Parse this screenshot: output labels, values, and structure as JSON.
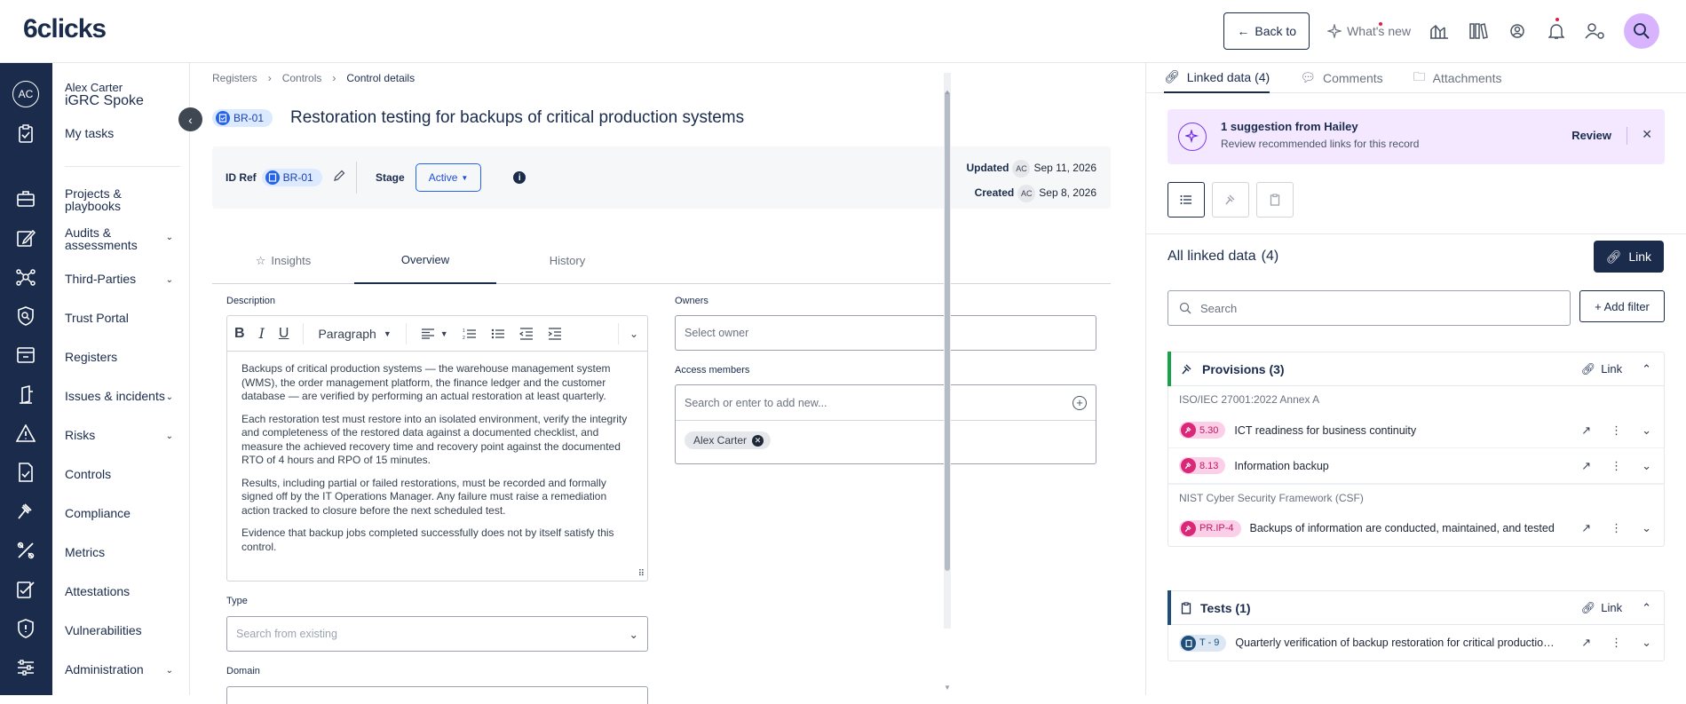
{
  "app": {
    "logo": "6clicks"
  },
  "topbar": {
    "back_label": "Back to",
    "whats_new_label": "What's new"
  },
  "user": {
    "initials": "AC",
    "name": "Alex Carter",
    "org": "iGRC Spoke"
  },
  "sidenav": {
    "my_tasks": "My tasks",
    "items": [
      {
        "label": "Projects & playbooks"
      },
      {
        "label": "Audits & assessments"
      },
      {
        "label": "Third-Parties"
      },
      {
        "label": "Trust Portal"
      },
      {
        "label": "Registers"
      },
      {
        "label": "Issues & incidents"
      },
      {
        "label": "Risks"
      },
      {
        "label": "Controls"
      },
      {
        "label": "Compliance"
      },
      {
        "label": "Metrics"
      },
      {
        "label": "Attestations"
      },
      {
        "label": "Vulnerabilities"
      },
      {
        "label": "Administration"
      }
    ]
  },
  "breadcrumb": {
    "items": [
      "Registers",
      "Controls",
      "Control details"
    ]
  },
  "record": {
    "id": "BR-01",
    "title": "Restoration testing for backups of critical production systems",
    "id_ref_label": "ID Ref",
    "stage_label": "Stage",
    "stage_value": "Active",
    "updated_label": "Updated",
    "updated_initials": "AC",
    "updated_date": "Sep 11, 2026",
    "created_label": "Created",
    "created_initials": "AC",
    "created_date": "Sep 8, 2026"
  },
  "tabs": [
    {
      "label": "Insights"
    },
    {
      "label": "Overview"
    },
    {
      "label": "History"
    }
  ],
  "form": {
    "description_label": "Description",
    "paragraph_style": "Paragraph",
    "description": [
      "Backups of critical production systems — the warehouse management system (WMS), the order management platform, the finance ledger and the customer database — are verified by performing an actual restoration at least quarterly.",
      "Each restoration test must restore into an isolated environment, verify the integrity and completeness of the restored data against a documented checklist, and measure the achieved recovery time and recovery point against the documented RTO of 4 hours and RPO of 15 minutes.",
      "Results, including partial or failed restorations, must be recorded and formally signed off by the IT Operations Manager. Any failure must raise a remediation action tracked to closure before the next scheduled test.",
      "Evidence that backup jobs completed successfully does not by itself satisfy this control."
    ],
    "type_label": "Type",
    "type_placeholder": "Search from existing",
    "domain_label": "Domain",
    "owners_label": "Owners",
    "owners_placeholder": "Select owner",
    "access_label": "Access members",
    "access_placeholder": "Search or enter to add new...",
    "access_member": "Alex Carter"
  },
  "right": {
    "tabs": [
      {
        "label": "Linked data (4)"
      },
      {
        "label": "Comments"
      },
      {
        "label": "Attachments"
      }
    ],
    "suggestion_title": "1 suggestion from Hailey",
    "suggestion_sub": "Review recommended links for this record",
    "review_label": "Review",
    "all_title": "All linked data",
    "all_count": "(4)",
    "link_label": "Link",
    "search_placeholder": "Search",
    "add_filter": "+ Add filter",
    "provisions": {
      "title": "Provisions (3)",
      "link": "Link",
      "frameworks": [
        {
          "name": "ISO/IEC 27001:2022 Annex A",
          "rows": [
            {
              "tag": "5.30",
              "text": "ICT readiness for business continuity"
            },
            {
              "tag": "8.13",
              "text": "Information backup"
            }
          ]
        },
        {
          "name": "NIST Cyber Security Framework (CSF)",
          "rows": [
            {
              "tag": "PR.IP-4",
              "text": "Backups of information are conducted, maintained, and tested"
            }
          ]
        }
      ]
    },
    "tests": {
      "title": "Tests (1)",
      "link": "Link",
      "rows": [
        {
          "tag": "T - 9",
          "text": "Quarterly verification of backup restoration for critical production systems"
        }
      ]
    }
  },
  "colors": {
    "navy": "#1a2b4c",
    "provision": "#db2777",
    "test": "#1e4e79",
    "accent": "#2563eb"
  }
}
